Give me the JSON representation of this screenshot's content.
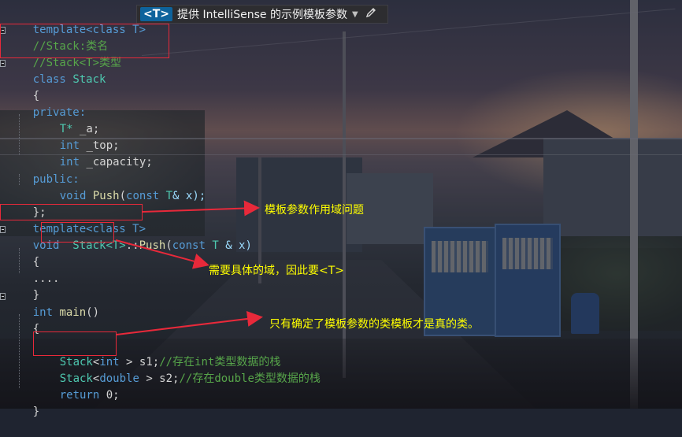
{
  "intellisense_bar": {
    "badge": "<T>",
    "text": "提供 IntelliSense 的示例模板参数"
  },
  "code": {
    "line_template_top": "template<class T>",
    "comment_stack_name": "//Stack:类名",
    "comment_stack_type": "//Stack<T>类型",
    "class_kw": "class",
    "class_name": "Stack",
    "brace_open_1": "{",
    "private_label": "private:",
    "member_a_type": "T*",
    "member_a_name": " _a;",
    "member_top_type": "int",
    "member_top_name": " _top;",
    "member_capacity_type": "int",
    "member_capacity_name": " _capacity;",
    "public_label": "public:",
    "push_decl_void": "void",
    "push_decl_name": " Push",
    "push_decl_open": "(",
    "push_decl_const": "const",
    "push_decl_T": " T",
    "push_decl_rest": "& x);",
    "brace_close_1": "};",
    "line_template_mid": "template<class T>",
    "push_def_void": "void",
    "push_def_scope": "Stack<T>",
    "push_def_colons": "::",
    "push_def_name": "Push",
    "push_def_open": "(",
    "push_def_const": "const",
    "push_def_T": " T",
    "push_def_rest": " & x)",
    "brace_open_2": "{",
    "ellipsis": "....",
    "brace_close_2": "}",
    "main_int": "int",
    "main_name": " main",
    "main_parens": "()",
    "brace_open_3": "{",
    "s1_type": "Stack",
    "s1_targ_open": "<",
    "s1_targ": "int",
    "s1_targ_close": " >",
    "s1_var": " s1;",
    "s1_comment": "//存在int类型数据的栈",
    "s2_type": "Stack",
    "s2_targ_open": "<",
    "s2_targ": "double",
    "s2_targ_close": " >",
    "s2_var": " s2;",
    "s2_comment": "//存在double类型数据的栈",
    "return_kw": "return",
    "return_val": " 0;",
    "brace_close_3": "}"
  },
  "annotations": {
    "note_scope": "模板参数作用域问题",
    "note_need_domain": "需要具体的域，因此要<T>",
    "note_real_class": "只有确定了模板参数的类模板才是真的类。"
  },
  "colors": {
    "annotation_red": "#e8293a",
    "annotation_text": "#ffff00",
    "keyword": "#569cd6",
    "type": "#4ec9b0",
    "comment": "#57a64a"
  }
}
